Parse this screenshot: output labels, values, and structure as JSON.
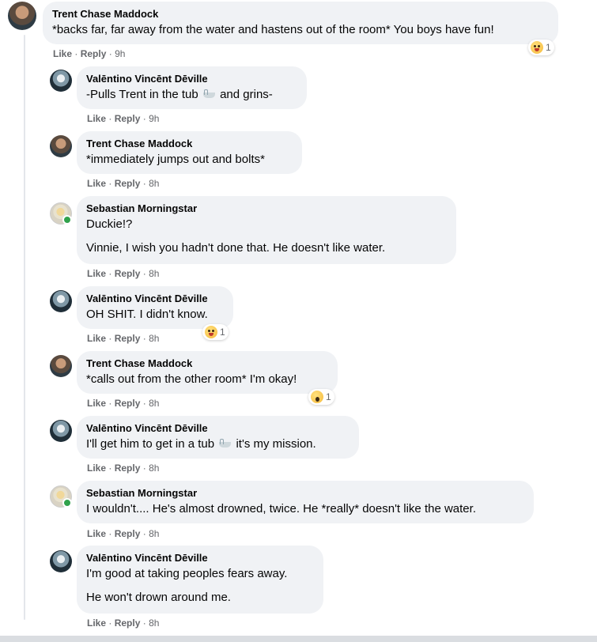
{
  "actions": {
    "like": "Like",
    "reply": "Reply",
    "separator": "·"
  },
  "comments": [
    {
      "author": "Trent Chase Maddock",
      "lines": [
        "*backs far, far away from the water and hastens out of the room* You boys have fun!"
      ],
      "time": "9h",
      "reaction": {
        "icon": "haha-emoji",
        "count": "1"
      }
    },
    {
      "author": "Valēntino Vincēnt Dēville",
      "lines": [
        "-Pulls Trent in the tub",
        "and grins-"
      ],
      "time": "9h"
    },
    {
      "author": "Trent Chase Maddock",
      "lines": [
        "*immediately jumps out and bolts*"
      ],
      "time": "8h"
    },
    {
      "author": "Sebastian Morningstar",
      "lines": [
        "Duckie!?",
        "Vinnie, I wish you hadn't done that. He doesn't like water."
      ],
      "time": "8h"
    },
    {
      "author": "Valēntino Vincēnt Dēville",
      "lines": [
        "OH SHIT. I didn't know."
      ],
      "time": "8h",
      "reaction": {
        "icon": "haha-emoji",
        "count": "1"
      }
    },
    {
      "author": "Trent Chase Maddock",
      "lines": [
        "*calls out from the other room* I'm okay!"
      ],
      "time": "8h",
      "reaction": {
        "icon": "wow-emoji",
        "count": "1"
      }
    },
    {
      "author": "Valēntino Vincēnt Dēville",
      "lines": [
        "I'll get him to get in a tub",
        "it's my mission."
      ],
      "time": "8h"
    },
    {
      "author": "Sebastian Morningstar",
      "lines": [
        "I wouldn't.... He's almost drowned, twice. He *really* doesn't like the water."
      ],
      "time": "8h"
    },
    {
      "author": "Valēntino Vincēnt Dēville",
      "lines": [
        "I'm good at taking peoples fears away.",
        "He won't drown around me."
      ],
      "time": "8h"
    }
  ]
}
